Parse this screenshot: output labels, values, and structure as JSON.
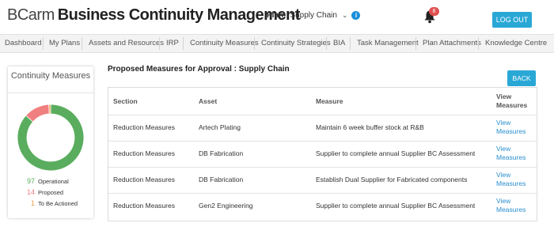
{
  "header": {
    "brand": "BCarm",
    "app_name": "Business Continuity Management",
    "plan_label": "Plan:",
    "plan_value": "Supply Chain",
    "notification_count": "8",
    "logout_label": "LOG OUT"
  },
  "nav": {
    "items": [
      "Dashboard",
      "My Plans",
      "Assets and Resources",
      "IRP",
      "Continuity Measures",
      "Continuity Strategies",
      "BIA",
      "Task Management",
      "Plan Attachments",
      "Knowledge Centre"
    ]
  },
  "card": {
    "title": "Continuity Measures",
    "stats": [
      {
        "value": "97",
        "label": "Operational",
        "color": "#5aad5e"
      },
      {
        "value": "14",
        "label": "Proposed",
        "color": "#f07f7f"
      },
      {
        "value": "1",
        "label": "To Be Actioned",
        "color": "#e8a050"
      }
    ]
  },
  "chart_data": {
    "type": "pie",
    "categories": [
      "Operational",
      "Proposed",
      "To Be Actioned"
    ],
    "values": [
      97,
      14,
      1
    ],
    "colors": [
      "#5aad5e",
      "#f07f7f",
      "#e8a050"
    ]
  },
  "main": {
    "title": "Proposed Measures for Approval : Supply Chain",
    "back_label": "BACK",
    "columns": [
      "Section",
      "Asset",
      "Measure",
      "View Measures"
    ],
    "rows": [
      {
        "section": "Reduction Measures",
        "asset": "Artech Plating",
        "measure": "Maintain 6 week buffer stock at R&B",
        "link": "View Measures"
      },
      {
        "section": "Reduction Measures",
        "asset": "DB Fabrication",
        "measure": "Supplier to complete annual Supplier BC Assessment",
        "link": "View Measures"
      },
      {
        "section": "Reduction Measures",
        "asset": "DB Fabrication",
        "measure": "Establish Dual Supplier for Fabricated components",
        "link": "View Measures"
      },
      {
        "section": "Reduction Measures",
        "asset": "Gen2 Engineering",
        "measure": "Supplier to complete annual Supplier BC Assessment",
        "link": "View Measures"
      }
    ]
  }
}
